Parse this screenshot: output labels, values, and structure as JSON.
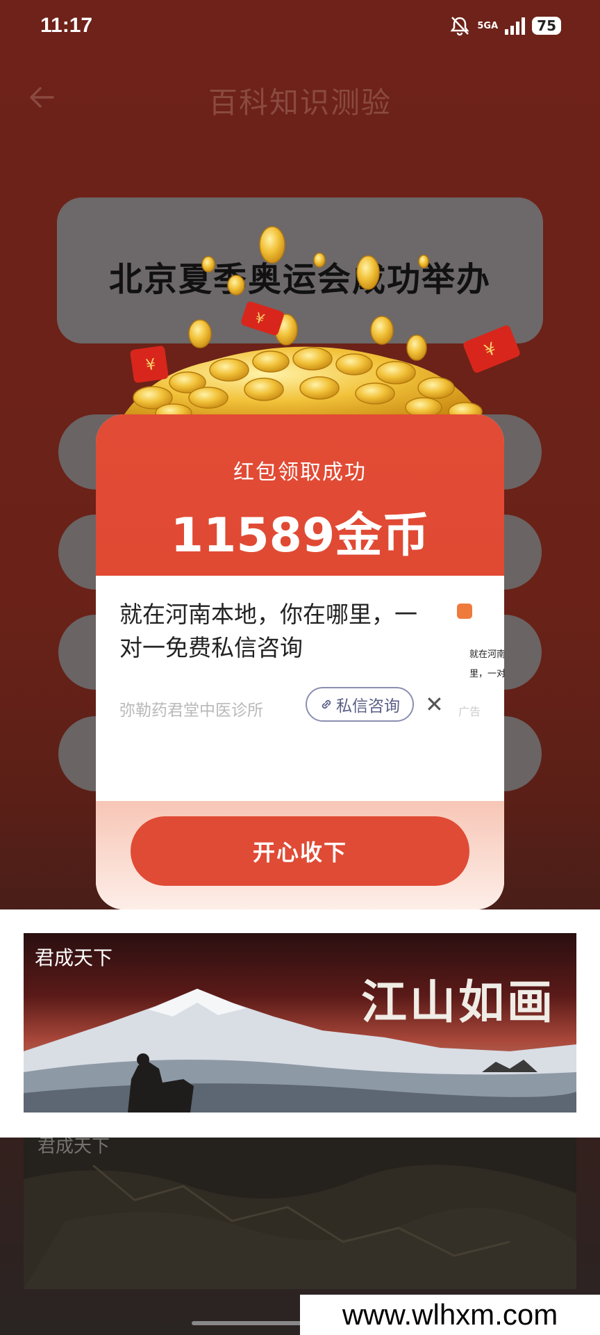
{
  "status_bar": {
    "time": "11:17",
    "network": "5GA",
    "battery": "75",
    "icons": [
      "bell-muted-icon",
      "signal-icon",
      "battery-icon"
    ]
  },
  "header": {
    "title": "百科知识测验",
    "back_icon": "arrow-left-icon"
  },
  "question": {
    "text": "北京夏季奥运会成功举办"
  },
  "reward_modal": {
    "subtitle": "红包领取成功",
    "amount": "11589金币",
    "ad": {
      "text": "就在河南本地，你在哪里，一对一免费私信咨询",
      "source": "弥勒药君堂中医诊所",
      "consult_button": "私信咨询",
      "peek_text_1": "就在河南",
      "peek_text_2": "里，一对",
      "peek_mark": "广告"
    },
    "accept_button": "开心收下"
  },
  "banner_ad": {
    "label": "君成天下",
    "slogan": "江山如画"
  },
  "banner_ad_2": {
    "label": "君成天下"
  },
  "watermark": "www.wlhxm.com",
  "colors": {
    "modal_red": "#e24b35",
    "page_bg": "#6e2219",
    "coin_gold": "#f2c23a"
  }
}
